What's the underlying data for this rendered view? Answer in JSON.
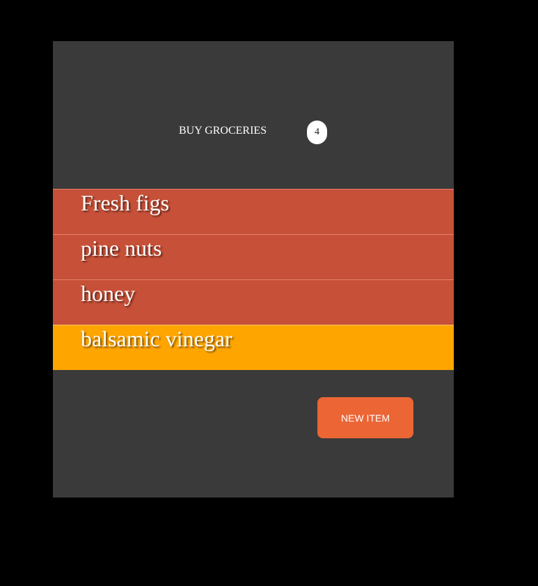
{
  "header": {
    "title": "BUY GROCERIES",
    "count": "4"
  },
  "items": [
    {
      "label": "Fresh figs",
      "highlighted": false
    },
    {
      "label": "pine nuts",
      "highlighted": false
    },
    {
      "label": "honey",
      "highlighted": false
    },
    {
      "label": "balsamic vinegar",
      "highlighted": true
    }
  ],
  "actions": {
    "new_item_label": "NEW ITEM"
  },
  "colors": {
    "panel_background": "#3a3a3a",
    "item_background": "#c65038",
    "highlight_background": "#ffa500",
    "button_background": "#ec6535"
  }
}
